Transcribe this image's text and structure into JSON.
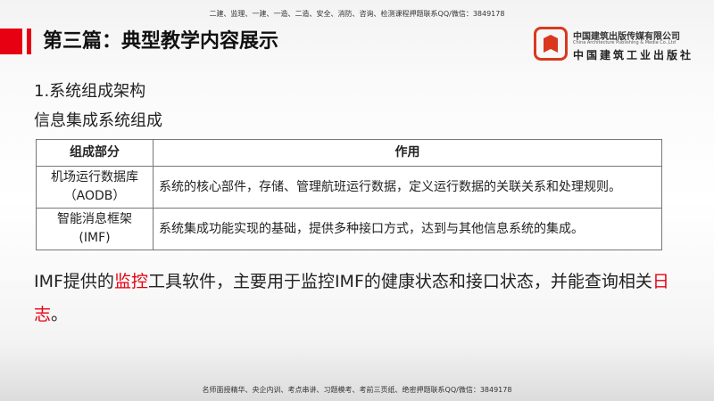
{
  "top_note": "二建、监理、一建、一造、二造、安全、消防、咨询、检测课程押题联系QQ/微信：3849178",
  "bottom_note": "名师面授精华、央企内训、考点串讲、习题模考、考前三页纸、绝密押题联系QQ/微信：3849178",
  "title": "第三篇：典型教学内容展示",
  "heading1": "1.系统组成架构",
  "heading2": "信息集成系统组成",
  "logo": {
    "cn": "中国建筑出版传媒有限公司",
    "en": "China Architecture Publishing & Media Co.,Ltd",
    "cn2": "中国建筑工业出版社"
  },
  "table": {
    "headers": [
      "组成部分",
      "作用"
    ],
    "rows": [
      [
        "机场运行数据库（AODB）",
        "系统的核心部件，存储、管理航班运行数据，定义运行数据的关联关系和处理规则。"
      ],
      [
        "智能消息框架(IMF)",
        "系统集成功能实现的基础，提供多种接口方式，达到与其他信息系统的集成。"
      ]
    ]
  },
  "paragraph": {
    "p1": "IMF提供的",
    "r1": "监控",
    "p2": "工具软件，主要用于监控IMF的健康状态和接口状态，并能查询相关",
    "r2": "日志",
    "p3": "。"
  },
  "colors": {
    "accent": "#e60012"
  }
}
